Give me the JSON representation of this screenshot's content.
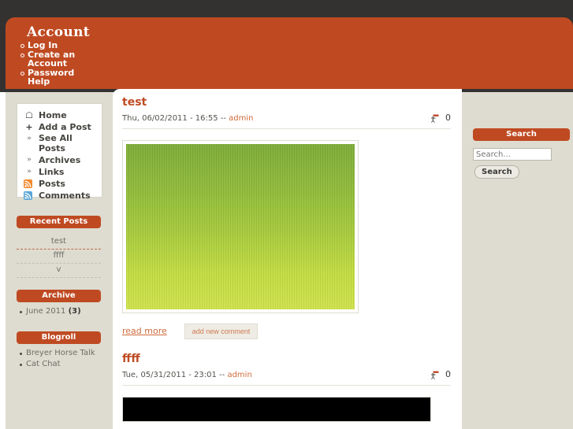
{
  "header": {
    "title": "Account",
    "menu": [
      {
        "label": "Log In"
      },
      {
        "label": "Create an Account"
      },
      {
        "label": "Password Help"
      }
    ]
  },
  "nav": {
    "items": [
      {
        "label": "Home",
        "icon": "home-icon"
      },
      {
        "label": "Add a Post",
        "icon": "plus-icon"
      },
      {
        "label": "See All Posts",
        "icon": "chevron-right-icon"
      },
      {
        "label": "Archives",
        "icon": "chevron-right-icon"
      },
      {
        "label": "Links",
        "icon": "chevron-right-icon"
      },
      {
        "label": "Posts",
        "icon": "rss-icon-orange"
      },
      {
        "label": "Comments",
        "icon": "rss-icon-blue"
      }
    ]
  },
  "recent_posts": {
    "title": "Recent Posts",
    "items": [
      {
        "label": "test"
      },
      {
        "label": "ffff"
      },
      {
        "label": "v"
      }
    ]
  },
  "archive": {
    "title": "Archive",
    "items": [
      {
        "label": "June 2011",
        "count": "(3)"
      }
    ]
  },
  "blogroll": {
    "title": "Blogroll",
    "items": [
      {
        "label": "Breyer Horse Talk"
      },
      {
        "label": "Cat Chat"
      }
    ]
  },
  "search": {
    "title": "Search",
    "placeholder": "Search...",
    "value": "",
    "button_label": "Search"
  },
  "posts": [
    {
      "title": "test",
      "submitted": "Thu, 06/02/2011 - 16:55 --",
      "author": "admin",
      "comment_count": "0",
      "read_more": "read more",
      "add_comment": "add new comment"
    },
    {
      "title": "ffff",
      "submitted": "Tue, 05/31/2011 - 23:01 --",
      "author": "admin",
      "comment_count": "0"
    }
  ],
  "colors": {
    "accent": "#bf4a22",
    "link": "#cf6b3c",
    "page_bg": "#dedcd0",
    "frame": "#333231"
  }
}
